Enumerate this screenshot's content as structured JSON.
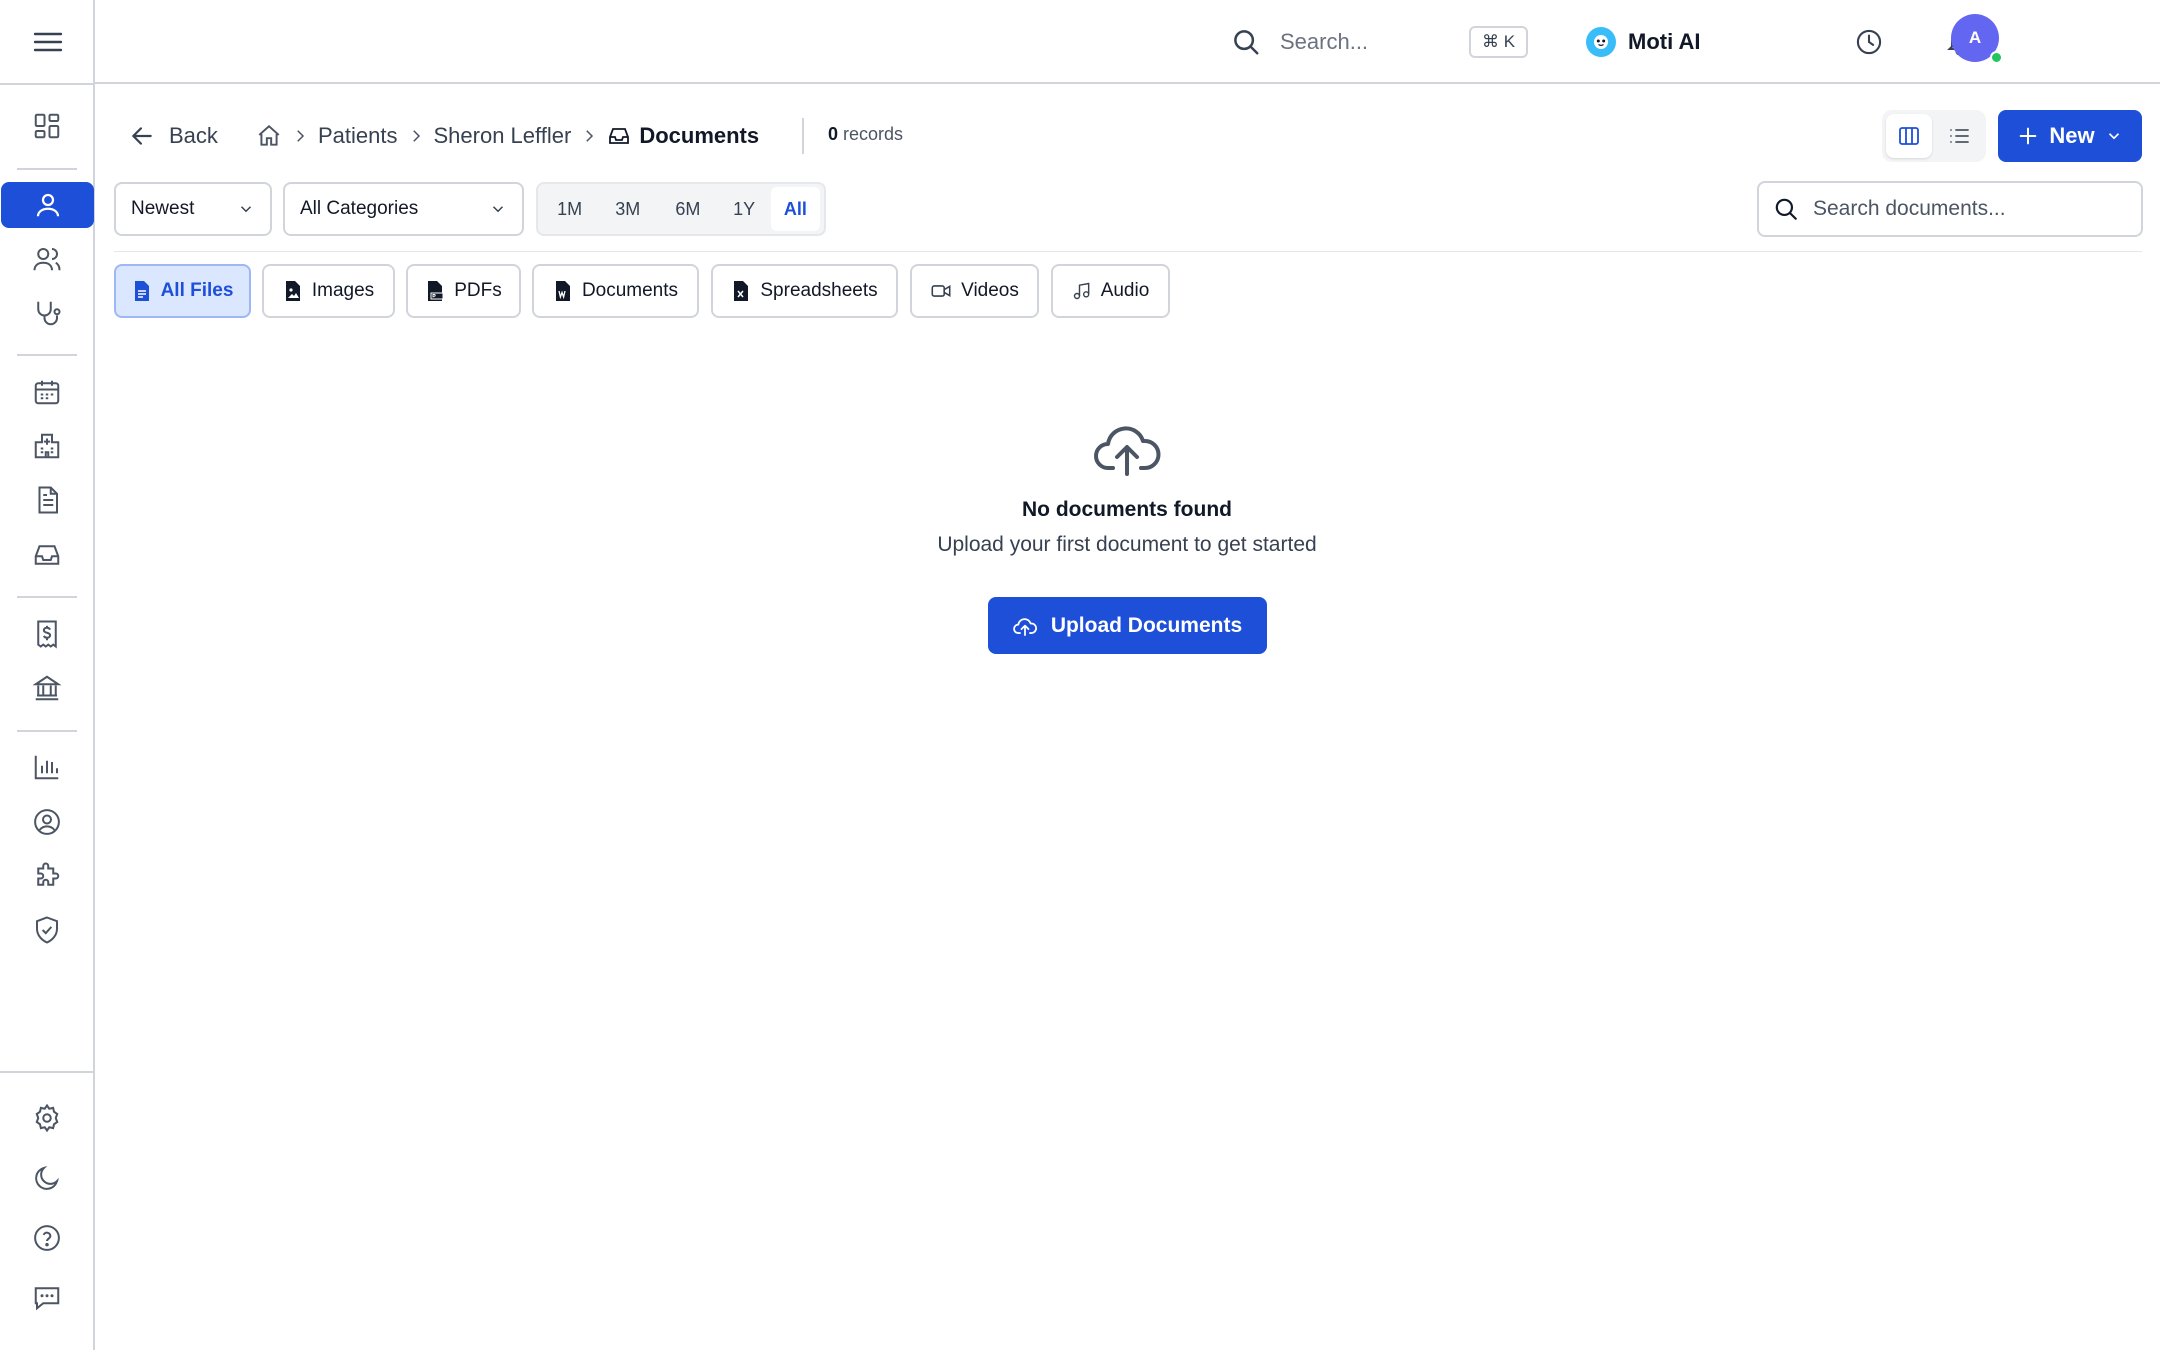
{
  "topbar": {
    "search_placeholder": "Search...",
    "shortcut": "⌘ K",
    "ai_label": "Moti AI",
    "avatar_initial": "A"
  },
  "breadcrumb": {
    "back_label": "Back",
    "items": [
      "Patients",
      "Sheron Leffler"
    ],
    "current": "Documents",
    "record_count": "0",
    "record_label": "records"
  },
  "actions": {
    "new_label": "New"
  },
  "filters": {
    "sort_value": "Newest",
    "category_value": "All Categories",
    "ranges": [
      "1M",
      "3M",
      "6M",
      "1Y",
      "All"
    ],
    "active_range": "All",
    "search_placeholder": "Search documents..."
  },
  "file_types": {
    "items": [
      "All Files",
      "Images",
      "PDFs",
      "Documents",
      "Spreadsheets",
      "Videos",
      "Audio"
    ],
    "active": "All Files"
  },
  "empty_state": {
    "title": "No documents found",
    "subtitle": "Upload your first document to get started",
    "button_label": "Upload Documents"
  },
  "colors": {
    "accent": "#1e4fd8",
    "accent_light": "#dbe7ff",
    "border": "#d1d5db",
    "status_online": "#22c55e",
    "avatar": "#6366f1"
  },
  "icons": {
    "sidebar": [
      "dashboard-icon",
      "patient-icon",
      "users-icon",
      "stethoscope-icon",
      "calendar-icon",
      "hospital-icon",
      "file-text-icon",
      "inbox-icon",
      "billing-icon",
      "bank-icon",
      "chart-icon",
      "user-circle-icon",
      "puzzle-icon",
      "shield-icon",
      "settings-icon",
      "moon-icon",
      "help-icon",
      "chat-icon"
    ]
  }
}
